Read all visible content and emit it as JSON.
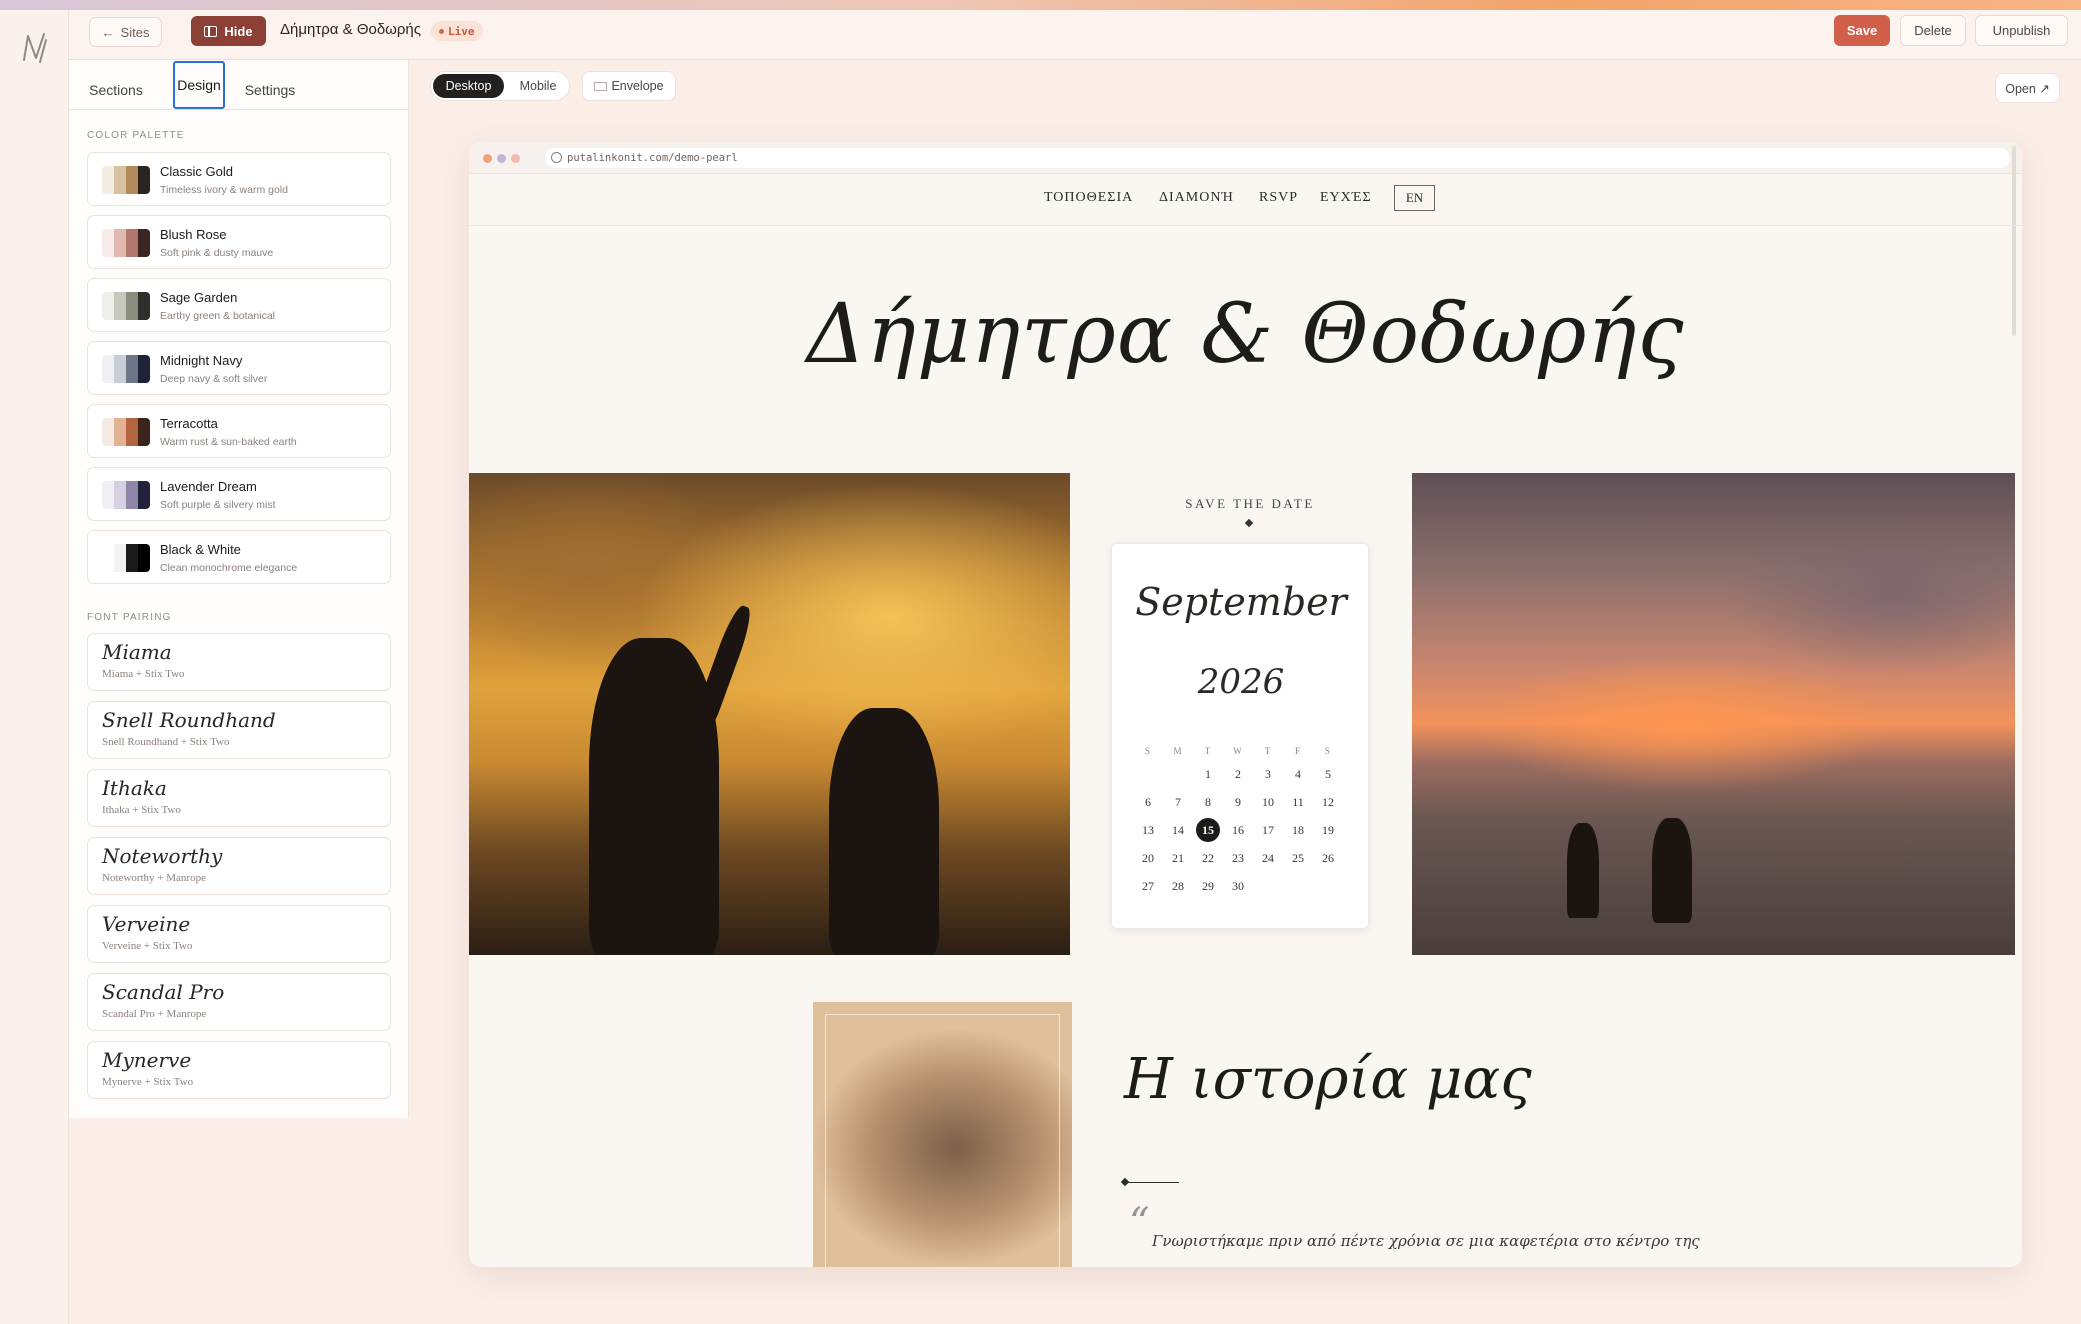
{
  "topbar": {
    "sites_label": "Sites",
    "hide_label": "Hide",
    "site_title": "Δήμητρα & Θοδωρής",
    "live_label": "Live",
    "save_label": "Save",
    "delete_label": "Delete",
    "unpublish_label": "Unpublish"
  },
  "panel": {
    "tabs": [
      "Sections",
      "Design",
      "Settings"
    ],
    "active_tab": "Design",
    "color_palette_label": "COLOR PALETTE",
    "palettes": [
      {
        "name": "Classic Gold",
        "desc": "Timeless ivory & warm gold",
        "colors": [
          "#f3ece3",
          "#d9c2a3",
          "#b08a5a",
          "#2b241f"
        ]
      },
      {
        "name": "Blush Rose",
        "desc": "Soft pink & dusty mauve",
        "colors": [
          "#f6ebe8",
          "#e2b9b1",
          "#b0776c",
          "#3a2623"
        ]
      },
      {
        "name": "Sage Garden",
        "desc": "Earthy green & botanical",
        "colors": [
          "#efefea",
          "#c7c9bd",
          "#8a8f7d",
          "#2e2e2b"
        ]
      },
      {
        "name": "Midnight Navy",
        "desc": "Deep navy & soft silver",
        "colors": [
          "#eef0f3",
          "#c9cdd6",
          "#6c7589",
          "#1e2338"
        ]
      },
      {
        "name": "Terracotta",
        "desc": "Warm rust & sun-baked earth",
        "colors": [
          "#f6ebe2",
          "#e3b293",
          "#b4643f",
          "#3b241a"
        ]
      },
      {
        "name": "Lavender Dream",
        "desc": "Soft purple & silvery mist",
        "colors": [
          "#f1eff5",
          "#d5d1e0",
          "#8e87a8",
          "#24213a"
        ]
      },
      {
        "name": "Black & White",
        "desc": "Clean monochrome elegance",
        "colors": [
          "#ffffff",
          "#f2f2f2",
          "#1a1a1a",
          "#000000"
        ]
      }
    ],
    "font_pairing_label": "FONT PAIRING",
    "fonts": [
      {
        "preview": "Miama",
        "desc": "Miama + Stix Two"
      },
      {
        "preview": "Snell Roundhand",
        "desc": "Snell Roundhand + Stix Two"
      },
      {
        "preview": "Ithaka",
        "desc": "Ithaka + Stix Two"
      },
      {
        "preview": "Noteworthy",
        "desc": "Noteworthy + Manrope"
      },
      {
        "preview": "Verveine",
        "desc": "Verveine + Stix Two"
      },
      {
        "preview": "Scandal Pro",
        "desc": "Scandal Pro + Manrope"
      },
      {
        "preview": "Mynerve",
        "desc": "Mynerve + Stix Two"
      }
    ]
  },
  "view": {
    "desktop_label": "Desktop",
    "mobile_label": "Mobile",
    "envelope_label": "Envelope",
    "open_label": "Open ↗"
  },
  "preview": {
    "url": "putalinkonit.com/demo-pearl",
    "nav": [
      "ΤΟΠΟΘΕΣΙΑ",
      "ΔΙΑΜΟΝΉ",
      "RSVP",
      "ΕΥΧΈΣ"
    ],
    "lang": "EN",
    "hero_title": "Δήμητρα & Θοδωρής",
    "save_the_date": "SAVE THE DATE",
    "month": "September",
    "year": "2026",
    "weekdays": [
      "S",
      "M",
      "T",
      "W",
      "T",
      "F",
      "S"
    ],
    "weeks": [
      [
        "",
        "",
        "1",
        "2",
        "3",
        "4",
        "5"
      ],
      [
        "6",
        "7",
        "8",
        "9",
        "10",
        "11",
        "12"
      ],
      [
        "13",
        "14",
        "15",
        "16",
        "17",
        "18",
        "19"
      ],
      [
        "20",
        "21",
        "22",
        "23",
        "24",
        "25",
        "26"
      ],
      [
        "27",
        "28",
        "29",
        "30",
        "",
        "",
        ""
      ]
    ],
    "highlight_day": "15",
    "story_title": "Η ιστορία μας",
    "quote_mark": "“",
    "story_text": "Γνωριστήκαμε πριν από πέντε χρόνια σε μια καφετέρια στο κέντρο της"
  }
}
